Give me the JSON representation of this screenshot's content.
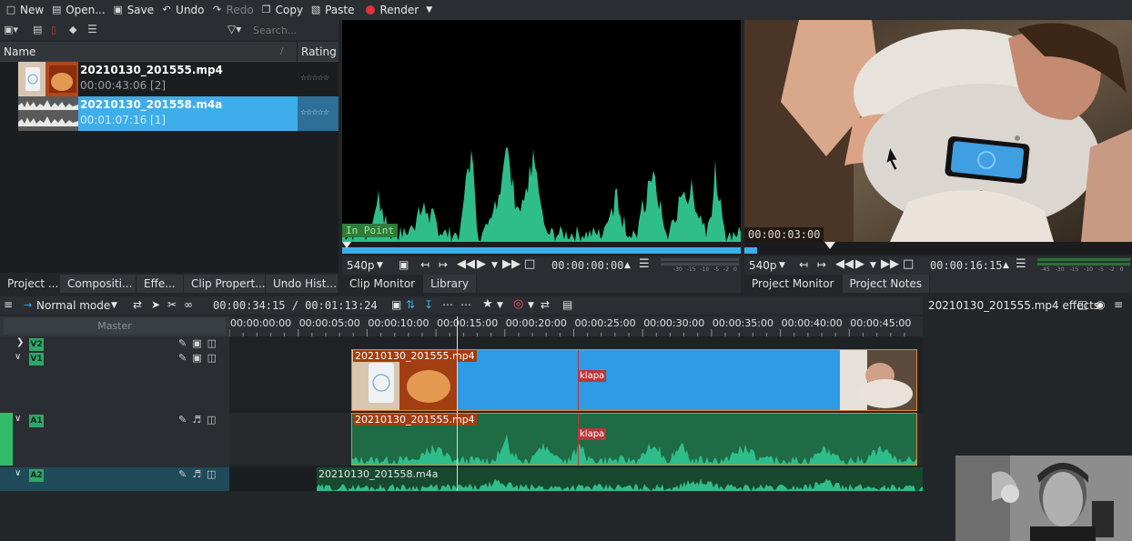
{
  "toolbar": {
    "new": "New",
    "open": "Open...",
    "save": "Save",
    "undo": "Undo",
    "redo": "Redo",
    "copy": "Copy",
    "paste": "Paste",
    "render": "Render"
  },
  "bin": {
    "search_placeholder": "Search...",
    "col_name": "Name",
    "col_rating": "Rating",
    "items": [
      {
        "title": "20210130_201555.mp4",
        "sub": "00:00:43:06 [2]"
      },
      {
        "title": "20210130_201558.m4a",
        "sub": "00:01:07:16 [1]"
      }
    ]
  },
  "left_tabs": [
    "Project ...",
    "Compositi...",
    "Effe...",
    "Clip Propert...",
    "Undo Hist..."
  ],
  "clip_monitor": {
    "in_point": "In Point",
    "zoom": "540p",
    "timecode": "00:00:00:00",
    "tabs": [
      "Clip Monitor",
      "Library"
    ]
  },
  "project_monitor": {
    "overlay_tc": "00:00:03:00",
    "zoom": "540p",
    "timecode": "00:00:16:15",
    "tabs": [
      "Project Monitor",
      "Project Notes"
    ]
  },
  "vu_scale": [
    "-30",
    "-15",
    "-10",
    "-5",
    "-2",
    "0"
  ],
  "vu_scale_right": [
    "-45",
    "-30",
    "-15",
    "-10",
    "-5",
    "-2",
    "0"
  ],
  "timeline": {
    "mode": "Normal mode",
    "position": "00:00:34:15 / 00:01:13:24",
    "master": "Master",
    "ruler": [
      "00:00:00:00",
      "00:00:05:00",
      "00:00:10:00",
      "00:00:15:00",
      "00:00:20:00",
      "00:00:25:00",
      "00:00:30:00",
      "00:00:35:00",
      "00:00:40:00",
      "00:00:45:00"
    ],
    "tracks": [
      "V2",
      "V1",
      "A1",
      "A2"
    ],
    "clip_v1": "20210130_201555.mp4",
    "clip_a1": "20210130_201555.mp4",
    "clip_a2": "20210130_201558.m4a",
    "marker": "klapa"
  },
  "effects": {
    "title": "20210130_201555.mp4 effects"
  },
  "colors": {
    "accent_blue": "#3daee9",
    "audio_green": "#2fbd8c",
    "clip_orange": "#e08a2e"
  }
}
